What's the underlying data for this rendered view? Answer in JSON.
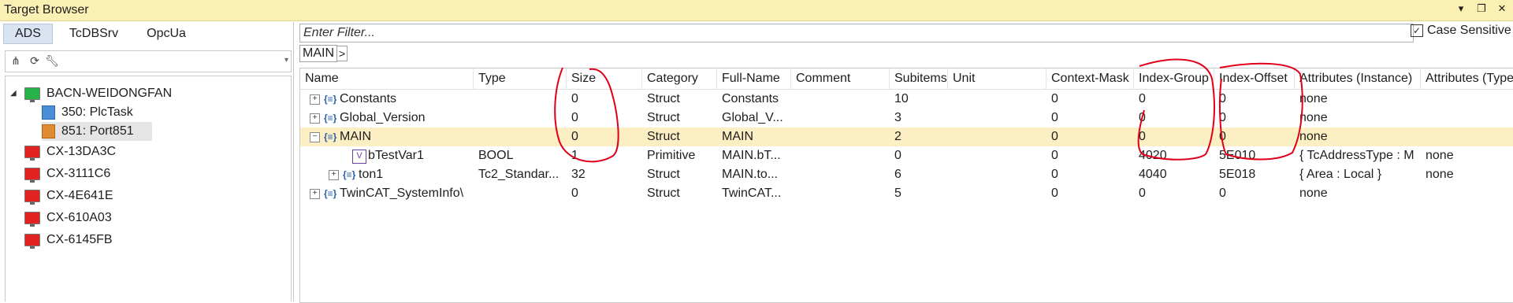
{
  "window": {
    "title": "Target Browser"
  },
  "left": {
    "tabs": [
      "ADS",
      "TcDBSrv",
      "OpcUa"
    ],
    "tree": [
      {
        "label": "BACN-WEIDONGFAN",
        "kind": "green"
      },
      {
        "label": "350: PlcTask",
        "kind": "plc"
      },
      {
        "label": "851: Port851",
        "kind": "port"
      },
      {
        "label": "CX-13DA3C",
        "kind": "red"
      },
      {
        "label": "CX-3111C6",
        "kind": "red"
      },
      {
        "label": "CX-4E641E",
        "kind": "red"
      },
      {
        "label": "CX-610A03",
        "kind": "red"
      },
      {
        "label": "CX-6145FB",
        "kind": "red"
      }
    ]
  },
  "filter": {
    "placeholder": "Enter Filter...",
    "case_label": "Case Sensitive"
  },
  "breadcrumb": {
    "item": "MAIN",
    "arrow": ">"
  },
  "columns": [
    "Name",
    "Type",
    "Size",
    "Category",
    "Full-Name",
    "Comment",
    "Subitems",
    "Unit",
    "Context-Mask",
    "Index-Group",
    "Index-Offset",
    "Attributes (Instance)",
    "Attributes (Type)"
  ],
  "rows": [
    {
      "name": "Constants",
      "type": "",
      "size": "0",
      "category": "Struct",
      "fullname": "Constants",
      "comment": "",
      "subitems": "10",
      "unit": "",
      "ctx": "0",
      "ig": "0",
      "io": "0",
      "attr_i": "none",
      "attr_t": ""
    },
    {
      "name": "Global_Version",
      "type": "",
      "size": "0",
      "category": "Struct",
      "fullname": "Global_V...",
      "comment": "",
      "subitems": "3",
      "unit": "",
      "ctx": "0",
      "ig": "0",
      "io": "0",
      "attr_i": "none",
      "attr_t": ""
    },
    {
      "name": "MAIN",
      "type": "",
      "size": "0",
      "category": "Struct",
      "fullname": "MAIN",
      "comment": "",
      "subitems": "2",
      "unit": "",
      "ctx": "0",
      "ig": "0",
      "io": "0",
      "attr_i": "none",
      "attr_t": ""
    },
    {
      "name": "bTestVar1",
      "type": "BOOL",
      "size": "1",
      "category": "Primitive",
      "fullname": "MAIN.bT...",
      "comment": "",
      "subitems": "0",
      "unit": "",
      "ctx": "0",
      "ig": "4020",
      "io": "5E010",
      "attr_i": "{ TcAddressType : M",
      "attr_t": "none"
    },
    {
      "name": "ton1",
      "type": "Tc2_Standar...",
      "size": "32",
      "category": "Struct",
      "fullname": "MAIN.to...",
      "comment": "",
      "subitems": "6",
      "unit": "",
      "ctx": "0",
      "ig": "4040",
      "io": "5E018",
      "attr_i": "{ Area : Local }",
      "attr_t": "none"
    },
    {
      "name": "TwinCAT_SystemInfo\\",
      "type": "",
      "size": "0",
      "category": "Struct",
      "fullname": "TwinCAT...",
      "comment": "",
      "subitems": "5",
      "unit": "",
      "ctx": "0",
      "ig": "0",
      "io": "0",
      "attr_i": "none",
      "attr_t": ""
    }
  ],
  "colors": {
    "title_bar": "#fbf0b4",
    "selected_row": "#fcefc3",
    "annotation": "#e0001a"
  }
}
